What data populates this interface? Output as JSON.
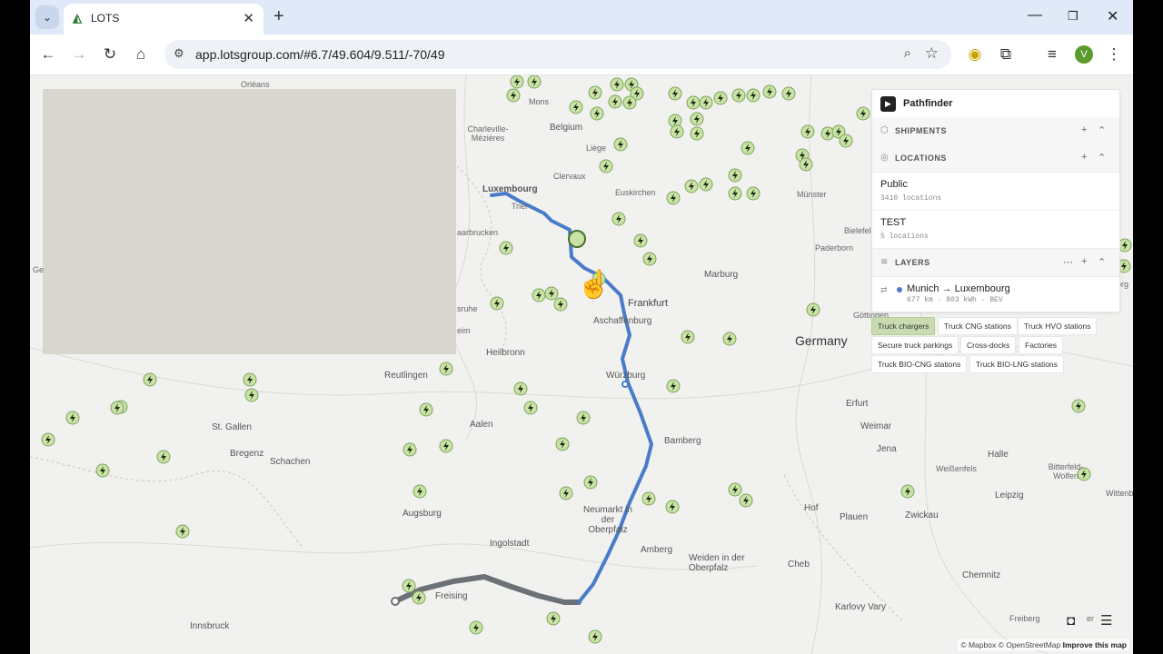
{
  "browser": {
    "tab_title": "LOTS",
    "new_tab": "+",
    "url": "app.lotsgroup.com/#6.7/49.604/9.511/-70/49",
    "profile_initial": "V"
  },
  "panel": {
    "title": "Pathfinder",
    "shipments_label": "SHIPMENTS",
    "locations_label": "LOCATIONS",
    "locations": [
      {
        "name": "Public",
        "count": "3410 locations"
      },
      {
        "name": "TEST",
        "count": "5 locations"
      }
    ],
    "layers_label": "LAYERS",
    "layer": {
      "name": "Munich → Luxembourg",
      "meta": "677 km · 803 kWh · BEV"
    }
  },
  "filters": [
    {
      "label": "Truck chargers",
      "active": true
    },
    {
      "label": "Truck CNG stations",
      "active": false
    },
    {
      "label": "Truck HVO stations",
      "active": false
    },
    {
      "label": "Secure truck parkings",
      "active": false
    },
    {
      "label": "Cross-docks",
      "active": false
    },
    {
      "label": "Factories",
      "active": false
    },
    {
      "label": "Truck BIO-CNG stations",
      "active": false
    },
    {
      "label": "Truck BIO-LNG stations",
      "active": false
    }
  ],
  "map_labels": {
    "belgium": "Belgium",
    "luxembourg": "Luxembourg",
    "germany": "Germany",
    "frankfurt": "Frankfurt",
    "aschaffenburg": "Aschaffenburg",
    "wurzburg": "Würzburg",
    "bamberg": "Bamberg",
    "freising": "Freising",
    "augsburg": "Augsburg",
    "ingolstadt": "Ingolstadt",
    "innsbruck": "Innsbruck",
    "reutlingen": "Reutlingen",
    "heilbronn": "Heilbronn",
    "aalen": "Aalen",
    "stgallen": "St. Gallen",
    "bregenz": "Bregenz",
    "schachen": "Schachen",
    "marburg": "Marburg",
    "erfurt": "Erfurt",
    "weimar": "Weimar",
    "jena": "Jena",
    "halle": "Halle",
    "leipzig": "Leipzig",
    "chemnitz": "Chemnitz",
    "plauen": "Plauen",
    "zwickau": "Zwickau",
    "hof": "Hof",
    "karlovy": "Karlovy Vary",
    "cheb": "Cheb",
    "amberg": "Amberg",
    "weiden": "Weiden in der Oberpfalz",
    "neumarkt": "Neumarkt in der Oberpfalz",
    "trier": "Trier",
    "liege": "Liège",
    "mons": "Mons",
    "charleville": "Charleville-Mézières",
    "orleans": "Orléans",
    "clervaux": "Clervaux",
    "euskirchen": "Euskirchen",
    "munster": "Münster",
    "paderborn": "Paderborn",
    "bielefeld": "Bielefeld",
    "gottingen": "Göttingen",
    "freiberg": "Freiberg",
    "wittenberg": "Wittenberg",
    "bitterfeld": "Bitterfeld-Wolfen",
    "weissenfels": "Weißenfels",
    "saarbrucken": "aarbrucken",
    "sruhe": "sruhe",
    "eim": "eim",
    "ge": "Ge",
    "org": "org",
    "er": "er"
  },
  "attribution": {
    "mapbox": "© Mapbox",
    "osm": "© OpenStreetMap",
    "improve": "Improve this map"
  },
  "colors": {
    "route_blue": "#4a7bc8",
    "route_gray": "#6b7177",
    "charger_fill": "#c9e3a6",
    "accent": "#c9dbb1"
  }
}
